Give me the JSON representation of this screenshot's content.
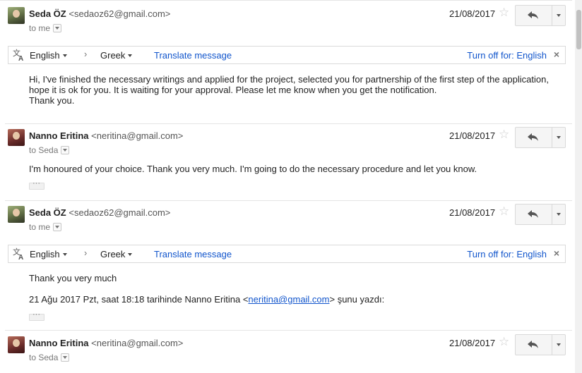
{
  "messages": [
    {
      "sender_name": "Seda ÖZ",
      "sender_email": "<sedaoz62@gmail.com>",
      "recipient": "to me",
      "date": "21/08/2017",
      "translate": {
        "source_lang": "English",
        "target_lang": "Greek",
        "translate_link": "Translate message",
        "turn_off": "Turn off for: English"
      },
      "body_lines": [
        "Hi, I've finished the necessary writings and applied for the project, selected you for partnership of the first step of the application,",
        "hope it is ok for you. It is waiting for your approval. Please let me know when you get the notification.",
        "Thank you."
      ]
    },
    {
      "sender_name": "Nanno Eritina",
      "sender_email": "<neritina@gmail.com>",
      "recipient": "to Seda",
      "date": "21/08/2017",
      "body_lines": [
        "I'm honoured of your choice. Thank you very much. I'm going to do the necessary procedure and let you know."
      ]
    },
    {
      "sender_name": "Seda ÖZ",
      "sender_email": "<sedaoz62@gmail.com>",
      "recipient": "to me",
      "date": "21/08/2017",
      "translate": {
        "source_lang": "English",
        "target_lang": "Greek",
        "translate_link": "Translate message",
        "turn_off": "Turn off for: English"
      },
      "body_lines": [
        "Thank you very much"
      ],
      "quote": {
        "prefix": "21 Ağu 2017 Pzt, saat 18:18 tarihinde Nanno Eritina <",
        "email": "neritina@gmail.com",
        "suffix": "> şunu yazdı:"
      }
    },
    {
      "sender_name": "Nanno Eritina",
      "sender_email": "<neritina@gmail.com>",
      "recipient": "to Seda",
      "date": "21/08/2017"
    }
  ],
  "icons": {
    "star": "star-icon",
    "reply": "reply-icon",
    "more": "chevron-down-icon",
    "translate": "translate-icon",
    "close": "close-icon"
  },
  "colors": {
    "link": "#1155cc",
    "border": "#dadada",
    "star": "#cccccc"
  }
}
